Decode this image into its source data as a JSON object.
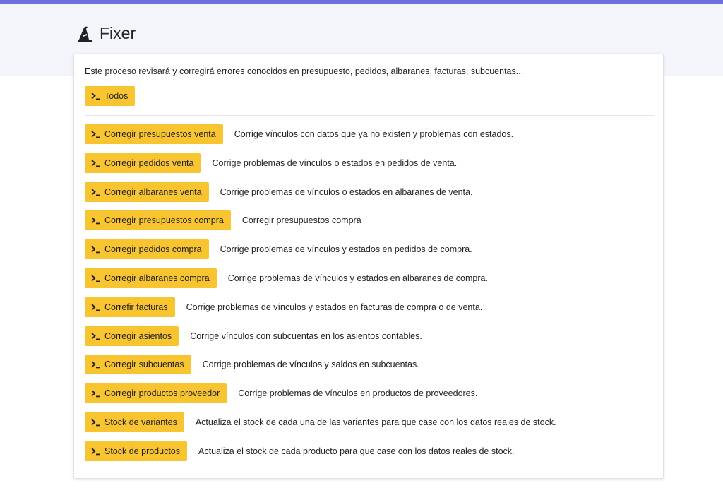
{
  "header": {
    "title": "Fixer",
    "icon": "wizard-hat-icon"
  },
  "colors": {
    "accent_bar": "#6c71db",
    "button": "#f8c531",
    "header_band": "#f4f5fa"
  },
  "intro": "Este proceso revisará y corregirá errores conocidos en presupuesto, pedidos, albaranes, facturas, subcuentas...",
  "all_button": {
    "label": "Todos",
    "icon": "terminal-icon"
  },
  "actions": [
    {
      "label": "Corregir presupuestos venta",
      "description": "Corrige vínculos con datos que ya no existen y problemas con estados."
    },
    {
      "label": "Corregir pedidos venta",
      "description": "Corrige problemas de vínculos o estados en pedidos de venta."
    },
    {
      "label": "Corregir albaranes venta",
      "description": "Corrige problemas de vínculos o estados en albaranes de venta."
    },
    {
      "label": "Corregir presupuestos compra",
      "description": "Corregir presupuestos compra"
    },
    {
      "label": "Corregir pedidos compra",
      "description": "Corrige problemas de vínculos y estados en pedidos de compra."
    },
    {
      "label": "Corregir albaranes compra",
      "description": "Corrige problemas de vínculos y estados en albaranes de compra."
    },
    {
      "label": "Correfir facturas",
      "description": "Corrige problemas de vínculos y estados en facturas de compra o de venta."
    },
    {
      "label": "Corregir asientos",
      "description": "Corrige vínculos con subcuentas en los asientos contables."
    },
    {
      "label": "Corregir subcuentas",
      "description": "Corrige problemas de vínculos y saldos en subcuentas."
    },
    {
      "label": "Corregir productos proveedor",
      "description": "Corrige problemas de vínculos en productos de proveedores."
    },
    {
      "label": "Stock de variantes",
      "description": "Actualiza el stock de cada una de las variantes para que case con los datos reales de stock."
    },
    {
      "label": "Stock de productos",
      "description": "Actualiza el stock de cada producto para que case con los datos reales de stock."
    }
  ]
}
